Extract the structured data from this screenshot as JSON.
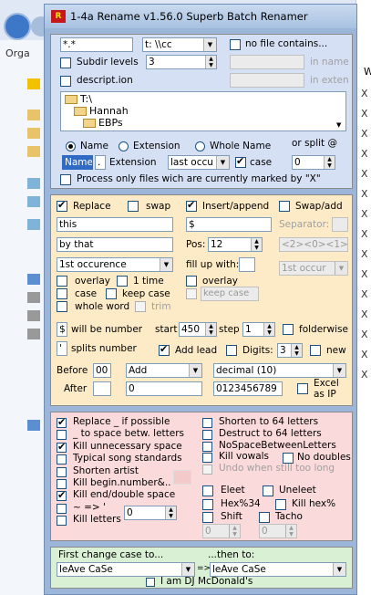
{
  "title": "1-4a Rename v1.56.0 Superb Batch Renamer",
  "explorer": {
    "organize": "Orga",
    "tail_label": "W"
  },
  "source": {
    "mask": "*.*",
    "drive": "t: \\\\cc",
    "subdir_label": "Subdir levels",
    "subdir_value": "3",
    "descript_label": "descript.ion",
    "no_file_label": "no file contains...",
    "in_name": "in name",
    "in_exten": "in exten",
    "tree": [
      "T:\\",
      "Hannah",
      "EBPs"
    ],
    "name_label": "Name",
    "extension_label": "Extension",
    "whole_name_label": "Whole Name",
    "or_split_label": "or split @",
    "name_btn": "Name",
    "ext_btn": ".",
    "extension2_label": "Extension",
    "occurrence": "last occu",
    "case_label": "case",
    "split_value": "0",
    "process_label": "Process only files wich are currently marked by \"X\""
  },
  "replace": {
    "replace_label": "Replace",
    "swap_label": "swap",
    "this_value": "this",
    "by_value": "by that",
    "occurence": "1st occurence",
    "overlay_label": "overlay",
    "one_time_label": "1 time",
    "case_label": "case",
    "keep_case_label": "keep case",
    "whole_word_label": "whole word",
    "trim_label": "trim"
  },
  "insert": {
    "insert_label": "Insert/append",
    "insert_value": "$",
    "pos_label": "Pos:",
    "pos_value": "12",
    "fill_label": "fill up with:",
    "overlay_label": "overlay",
    "keep_case_label": "keep case"
  },
  "swap": {
    "swap_add_label": "Swap/add",
    "separator_label": "Separator:",
    "pattern": "<2><0><1>",
    "occur": "1st occur"
  },
  "number": {
    "dollar": "$",
    "will_be_number": "will be number",
    "quote": "'",
    "splits_number": "splits number",
    "start_label": "start",
    "start_value": "450",
    "step_label": "step",
    "step_value": "1",
    "folderwise_label": "folderwise",
    "add_lead_label": "Add lead",
    "digits_label": "Digits:",
    "digits_value": "3",
    "new_label": "new"
  },
  "before_after": {
    "before_label": "Before",
    "before_value": "00",
    "after_label": "After",
    "add_value": "Add",
    "after_num": "0",
    "format": "decimal (10)",
    "digits_chars": "0123456789",
    "excel_label1": "Excel",
    "excel_label2": "as IP"
  },
  "cleanup": {
    "left": [
      "Replace _ if possible",
      "_ to space betw. letters",
      "Kill unnecessary space",
      "Typical song standards",
      "Shorten artist",
      "Kill begin.number&..",
      "Kill end/double space",
      "~ => '",
      "Kill letters"
    ],
    "left_checked": [
      true,
      false,
      true,
      false,
      false,
      false,
      true,
      false,
      false
    ],
    "kill_letters_value": "0",
    "right": [
      "Shorten to 64 letters",
      "Destruct to 64 letters",
      "NoSpaceBetweenLetters",
      "Kill vowals",
      "Undo when still too long"
    ],
    "no_doubles_label": "No doubles",
    "eleet_label": "Eleet",
    "uneleet_label": "Uneleet",
    "hex34_label": "Hex%34",
    "kill_hex_label": "Kill hex%",
    "shift_label": "Shift",
    "tacho_label": "Tacho",
    "shift_value": "0",
    "tacho_value": "0"
  },
  "case_change": {
    "first_label": "First change case to...",
    "then_label": "...then to:",
    "first_value": "leAve CaSe",
    "arrow": "=>",
    "then_value": "leAve CaSe",
    "dj_label": "I am DJ McDonald's"
  },
  "right_marks": [
    "X",
    "X",
    "X",
    "X",
    "X",
    "X",
    "X",
    "X",
    "X",
    "X",
    "X",
    "X",
    "X",
    "X",
    "X"
  ]
}
